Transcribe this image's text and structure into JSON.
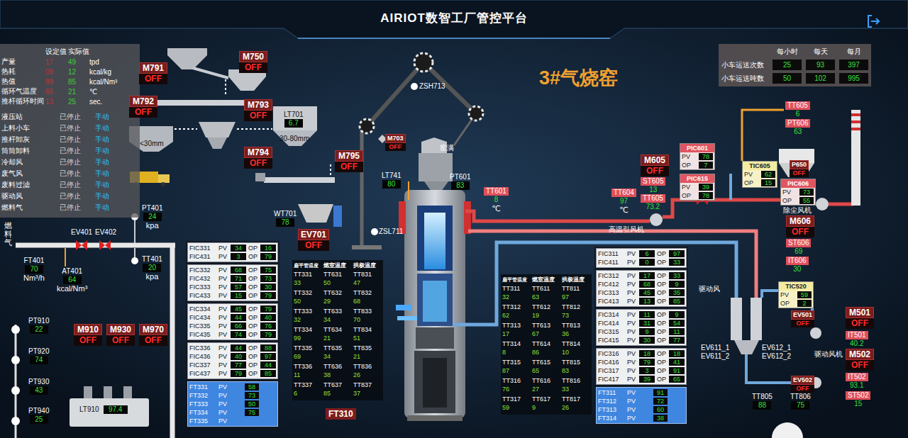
{
  "header": {
    "title": "AIRIOT数智工厂管控平台"
  },
  "kiln_title": "3#气烧窑",
  "process_table": {
    "headers": [
      "设定值",
      "实际值"
    ],
    "rows": [
      {
        "label": "产量",
        "set": "17",
        "actual": "49",
        "unit": "tpd"
      },
      {
        "label": "热耗",
        "set": "09",
        "actual": "12",
        "unit": "kcal/kg"
      },
      {
        "label": "热值",
        "set": "89",
        "actual": "85",
        "unit": "kcal/Nm³"
      },
      {
        "label": "循环气温度",
        "set": "65",
        "actual": "21",
        "unit": "℃"
      },
      {
        "label": "推杆循环时间",
        "set": "13",
        "actual": "25",
        "unit": "sec."
      }
    ]
  },
  "equipment": [
    {
      "name": "液压站",
      "status": "已停止",
      "mode": "手动"
    },
    {
      "name": "上料小车",
      "status": "已停止",
      "mode": "手动"
    },
    {
      "name": "推杆卸灰",
      "status": "已停止",
      "mode": "手动"
    },
    {
      "name": "筒筒卸料",
      "status": "已停止",
      "mode": "手动"
    },
    {
      "name": "冷却风",
      "status": "已停止",
      "mode": "手动"
    },
    {
      "name": "废气风",
      "status": "已停止",
      "mode": "手动"
    },
    {
      "name": "废料过滤",
      "status": "已停止",
      "mode": "手动"
    },
    {
      "name": "驱动风",
      "status": "已停止",
      "mode": "手动"
    },
    {
      "name": "燃料气",
      "status": "已停止",
      "mode": "手动"
    }
  ],
  "transport_stats": {
    "columns": [
      "每小时",
      "每天",
      "每月"
    ],
    "rows": [
      {
        "label": "小车运送次数",
        "values": [
          "25",
          "93",
          "397"
        ]
      },
      {
        "label": "小车运送吨数",
        "values": [
          "50",
          "102",
          "995"
        ]
      }
    ]
  },
  "pv_label": "PV",
  "op_label": "OP",
  "motors": [
    {
      "tag": "M791",
      "state": "OFF",
      "running": false,
      "kind": "large"
    },
    {
      "tag": "M750",
      "state": "OFF",
      "running": false,
      "kind": "large"
    },
    {
      "tag": "M792",
      "state": "OFF",
      "running": false,
      "kind": "large"
    },
    {
      "tag": "M793",
      "state": "OFF",
      "running": false,
      "kind": "large"
    },
    {
      "tag": "M794",
      "state": "OFF",
      "running": false,
      "kind": "large"
    },
    {
      "tag": "M795",
      "state": "OFF",
      "running": false,
      "kind": "large"
    },
    {
      "tag": "M703",
      "state": "OFF",
      "running": false,
      "kind": "small"
    },
    {
      "tag": "EV701",
      "state": "OFF",
      "running": false,
      "kind": "large"
    },
    {
      "tag": "M910",
      "state": "OFF",
      "running": false,
      "kind": "large"
    },
    {
      "tag": "M930",
      "state": "OFF",
      "running": false,
      "kind": "large"
    },
    {
      "tag": "M970",
      "state": "OFF",
      "running": false,
      "kind": "large"
    },
    {
      "tag": "M605",
      "state": "OFF",
      "running": false,
      "kind": "large"
    },
    {
      "tag": "M606",
      "state": "OFF",
      "running": false,
      "kind": "large"
    },
    {
      "tag": "M501",
      "state": "OFF",
      "running": false,
      "kind": "large"
    },
    {
      "tag": "M502",
      "state": "OFF",
      "running": false,
      "kind": "large"
    },
    {
      "tag": "EV501",
      "state": "OFF",
      "running": false,
      "kind": "small"
    },
    {
      "tag": "EV502",
      "state": "OFF",
      "running": false,
      "kind": "small"
    },
    {
      "tag": "P650",
      "state": "OFF",
      "running": false,
      "kind": "small"
    }
  ],
  "readings": [
    {
      "tag": "LT701",
      "value": "6.7",
      "kind": "dark"
    },
    {
      "tag": "LT741",
      "value": "80",
      "kind": "plain"
    },
    {
      "tag": "PT601",
      "value": "83",
      "kind": "plain"
    },
    {
      "tag": "WT701",
      "value": "78",
      "kind": "plain"
    },
    {
      "tag": "PT401",
      "value": "24",
      "unit": "kpa",
      "kind": "plain"
    },
    {
      "tag": "FT401",
      "value": "70",
      "unit": "Nm³/h",
      "kind": "plain"
    },
    {
      "tag": "AT401",
      "value": "64",
      "unit": "kcal/Nm³",
      "kind": "plain"
    },
    {
      "tag": "TT401",
      "value": "20",
      "unit": "kpa",
      "kind": "plain"
    },
    {
      "tag": "PT910",
      "value": "22",
      "kind": "plain"
    },
    {
      "tag": "PT920",
      "value": "74",
      "kind": "plain"
    },
    {
      "tag": "PT930",
      "value": "43",
      "kind": "plain"
    },
    {
      "tag": "PT940",
      "value": "25",
      "kind": "plain"
    },
    {
      "tag": "TT605",
      "value": "6",
      "kind": "alarm"
    },
    {
      "tag": "PT606",
      "value": "63",
      "kind": "alarm"
    },
    {
      "tag": "ST605",
      "value": "13",
      "kind": "alarm"
    },
    {
      "tag": "TT605",
      "value": "73.2",
      "kind": "alarm"
    },
    {
      "tag": "TT604",
      "value": "97",
      "unit": "℃",
      "kind": "alarm"
    },
    {
      "tag": "TT601",
      "value": "8",
      "unit": "℃",
      "kind": "alarm"
    },
    {
      "tag": "ST606",
      "value": "69",
      "kind": "alarm"
    },
    {
      "tag": "IT606",
      "value": "30",
      "kind": "alarm"
    },
    {
      "tag": "IT501",
      "value": "40.2",
      "kind": "alarm"
    },
    {
      "tag": "IT502",
      "value": "93.1",
      "kind": "alarm"
    },
    {
      "tag": "ST502",
      "value": "15",
      "kind": "alarm"
    },
    {
      "tag": "TT805",
      "value": "88",
      "kind": "plain"
    },
    {
      "tag": "TT806",
      "value": "75",
      "kind": "plain"
    },
    {
      "tag": "LT910",
      "value": "97.4",
      "kind": "inline"
    }
  ],
  "controllers": [
    {
      "tag": "PIC601",
      "pv": "78",
      "op": "7",
      "alarm": true
    },
    {
      "tag": "PIC615",
      "pv": "39",
      "op": "78",
      "alarm": true
    },
    {
      "tag": "TIC605",
      "pv": "62",
      "op": "15",
      "alarm": false
    },
    {
      "tag": "PIC606",
      "pv": "73",
      "op": "55",
      "alarm": true
    },
    {
      "tag": "TIC520",
      "pv": "59",
      "op": "2",
      "alarm": false
    }
  ],
  "labels": [
    {
      "text": "ZSH713",
      "kind": "text"
    },
    {
      "text": "窑满",
      "kind": "text"
    },
    {
      "text": "ZSL711",
      "kind": "text"
    },
    {
      "text": "30-80mm",
      "kind": "dark"
    },
    {
      "text": "<30mm",
      "kind": "dark"
    },
    {
      "text": "高温引风机",
      "kind": "text"
    },
    {
      "text": "除尘风机",
      "kind": "text"
    },
    {
      "text": "驱动风",
      "kind": "text"
    },
    {
      "text": "驱动风机",
      "kind": "text"
    },
    {
      "text": "EV611_1",
      "kind": "text"
    },
    {
      "text": "EV611_2",
      "kind": "text"
    },
    {
      "text": "EV612_1",
      "kind": "text"
    },
    {
      "text": "EV612_2",
      "kind": "text"
    },
    {
      "text": "EV401",
      "kind": "text"
    },
    {
      "text": "EV402",
      "kind": "text"
    },
    {
      "text": "FT310",
      "kind": "tagbox"
    },
    {
      "text": "燃料气",
      "kind": "vertical"
    }
  ],
  "fic_left": {
    "groups": [
      [
        {
          "tag": "FIC331",
          "pv": "34",
          "op": "16"
        },
        {
          "tag": "FIC431",
          "pv": "3",
          "op": "79"
        }
      ],
      [
        {
          "tag": "FIC332",
          "pv": "68",
          "op": "75"
        },
        {
          "tag": "FIC432",
          "pv": "71",
          "op": "73"
        },
        {
          "tag": "FIC333",
          "pv": "57",
          "op": "30"
        },
        {
          "tag": "FIC433",
          "pv": "15",
          "op": "79"
        }
      ],
      [
        {
          "tag": "FIC334",
          "pv": "45",
          "op": "79"
        },
        {
          "tag": "FIC434",
          "pv": "44",
          "op": "40"
        },
        {
          "tag": "FIC335",
          "pv": "66",
          "op": "76"
        },
        {
          "tag": "FIC435",
          "pv": "74",
          "op": "79"
        }
      ],
      [
        {
          "tag": "FIC336",
          "pv": "44",
          "op": "88"
        },
        {
          "tag": "FIC436",
          "pv": "40",
          "op": "97"
        },
        {
          "tag": "FIC337",
          "pv": "77",
          "op": "44"
        },
        {
          "tag": "FIC437",
          "pv": "79",
          "op": "85"
        }
      ]
    ],
    "flow": [
      {
        "tag": "FT331",
        "pv": "58"
      },
      {
        "tag": "FT332",
        "pv": "73"
      },
      {
        "tag": "FT333",
        "pv": "50"
      },
      {
        "tag": "FT334",
        "pv": "75"
      },
      {
        "tag": "FT335"
      }
    ]
  },
  "fic_right": {
    "groups": [
      [
        {
          "tag": "FIC311",
          "pv": "6",
          "op": "97"
        },
        {
          "tag": "FIC411",
          "pv": "0",
          "op": "33"
        }
      ],
      [
        {
          "tag": "FIC312",
          "pv": "17",
          "op": "33"
        },
        {
          "tag": "FIC412",
          "pv": "68",
          "op": "9"
        },
        {
          "tag": "FIC313",
          "pv": "45",
          "op": "35"
        },
        {
          "tag": "FIC413",
          "pv": "13",
          "op": "85"
        }
      ],
      [
        {
          "tag": "FIC314",
          "pv": "11",
          "op": "9"
        },
        {
          "tag": "FIC414",
          "pv": "31",
          "op": "54"
        },
        {
          "tag": "FIC315",
          "pv": "9",
          "op": "11"
        },
        {
          "tag": "FIC415",
          "pv": "30",
          "op": "77"
        }
      ],
      [
        {
          "tag": "FIC316",
          "pv": "18",
          "op": "18"
        },
        {
          "tag": "FIC416",
          "pv": "79",
          "op": "41"
        },
        {
          "tag": "FIC317",
          "pv": "3",
          "op": "91"
        },
        {
          "tag": "FIC417",
          "pv": "39",
          "op": "65"
        }
      ]
    ],
    "flow": [
      {
        "tag": "FT311",
        "pv": "91"
      },
      {
        "tag": "FT312",
        "pv": "72"
      },
      {
        "tag": "FT313",
        "pv": "60"
      },
      {
        "tag": "FT314",
        "pv": "38"
      }
    ]
  },
  "temp_left": {
    "headers": [
      "扁平管温度",
      "燃室温度",
      "拱极温度"
    ],
    "rows": [
      [
        {
          "tag": "TT331",
          "value": "33"
        },
        {
          "tag": "TT631",
          "value": "50"
        },
        {
          "tag": "TT831",
          "value": "47"
        }
      ],
      [
        {
          "tag": "TT332",
          "value": "50"
        },
        {
          "tag": "TT632",
          "value": "29"
        },
        {
          "tag": "TT832",
          "value": "68"
        }
      ],
      [
        {
          "tag": "TT333",
          "value": "32"
        },
        {
          "tag": "TT633",
          "value": "34"
        },
        {
          "tag": "TT833",
          "value": "70"
        }
      ],
      [
        {
          "tag": "TT334",
          "value": "99"
        },
        {
          "tag": "TT634",
          "value": "21"
        },
        {
          "tag": "TT834",
          "value": "51"
        }
      ],
      [
        {
          "tag": "TT335",
          "value": "69"
        },
        {
          "tag": "TT635",
          "value": "34"
        },
        {
          "tag": "TT835",
          "value": "21"
        }
      ],
      [
        {
          "tag": "TT336",
          "value": "11"
        },
        {
          "tag": "TT636",
          "value": "38"
        },
        {
          "tag": "TT836",
          "value": "26"
        }
      ],
      [
        {
          "tag": "TT337",
          "value": "6"
        },
        {
          "tag": "TT637",
          "value": "85"
        },
        {
          "tag": "TT837",
          "value": "37"
        }
      ]
    ]
  },
  "temp_right": {
    "headers": [
      "扁平管温度",
      "燃室温度",
      "拱极温度"
    ],
    "rows": [
      [
        {
          "tag": "TT311",
          "value": "32"
        },
        {
          "tag": "TT611",
          "value": "63"
        },
        {
          "tag": "TT811",
          "value": "97"
        }
      ],
      [
        {
          "tag": "TT312",
          "value": "62"
        },
        {
          "tag": "TT612",
          "value": "19"
        },
        {
          "tag": "TT812",
          "value": "73"
        }
      ],
      [
        {
          "tag": "TT313",
          "value": "17"
        },
        {
          "tag": "TT613",
          "value": "67"
        },
        {
          "tag": "TT813",
          "value": "36"
        }
      ],
      [
        {
          "tag": "TT314",
          "value": "8"
        },
        {
          "tag": "TT614",
          "value": "86"
        },
        {
          "tag": "TT814",
          "value": "10"
        }
      ],
      [
        {
          "tag": "TT315",
          "value": "87"
        },
        {
          "tag": "TT615",
          "value": "65"
        },
        {
          "tag": "TT815",
          "value": "83"
        }
      ],
      [
        {
          "tag": "TT316",
          "value": "76"
        },
        {
          "tag": "TT616",
          "value": "27"
        },
        {
          "tag": "TT816",
          "value": "33"
        }
      ],
      [
        {
          "tag": "TT317",
          "value": "59"
        },
        {
          "tag": "TT617",
          "value": "9"
        },
        {
          "tag": "TT817",
          "value": "26"
        }
      ]
    ]
  }
}
